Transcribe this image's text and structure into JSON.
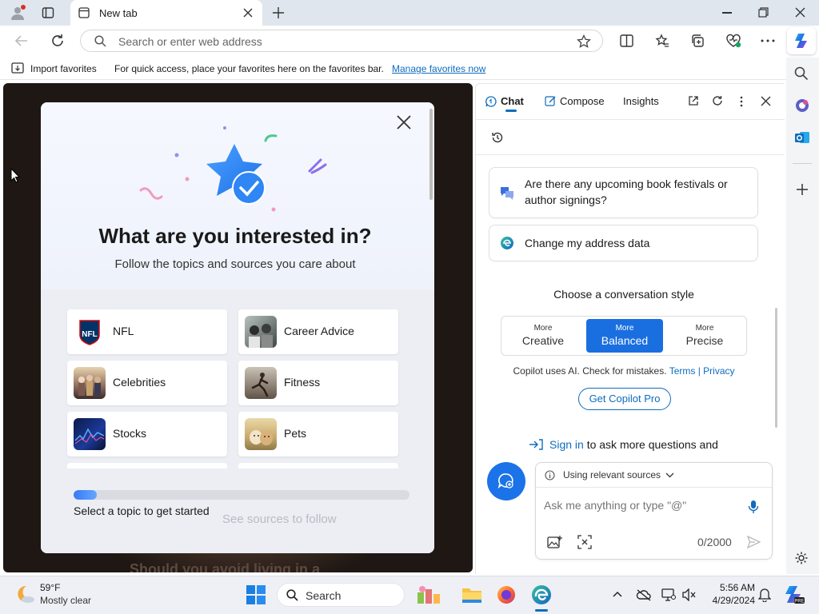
{
  "browser": {
    "tab_title": "New tab",
    "address_placeholder": "Search or enter web address",
    "favorites_bar": {
      "import_label": "Import favorites",
      "hint_text": "For quick access, place your favorites here on the favorites bar.",
      "manage_link": "Manage favorites now"
    }
  },
  "modal": {
    "title": "What are you interested in?",
    "subtitle": "Follow the topics and sources you care about",
    "topics": [
      {
        "label": "NFL",
        "thumb": "nfl-logo"
      },
      {
        "label": "Career Advice",
        "thumb": "career-photo"
      },
      {
        "label": "Celebrities",
        "thumb": "celebrities-photo"
      },
      {
        "label": "Fitness",
        "thumb": "fitness-photo"
      },
      {
        "label": "Stocks",
        "thumb": "stocks-photo"
      },
      {
        "label": "Pets",
        "thumb": "pets-photo"
      }
    ],
    "progress_fraction": 0.07,
    "progress_label": "Select a topic to get started",
    "next_label": "See sources to follow"
  },
  "background_headline": "Should you avoid living in a",
  "copilot": {
    "tabs": {
      "chat": "Chat",
      "compose": "Compose",
      "insights": "Insights"
    },
    "suggestions": [
      {
        "text": "Are there any upcoming book festivals or author signings?"
      },
      {
        "text": "Change my address data"
      }
    ],
    "style_heading": "Choose a conversation style",
    "styles": [
      {
        "small": "More",
        "big": "Creative",
        "selected": false
      },
      {
        "small": "More",
        "big": "Balanced",
        "selected": true
      },
      {
        "small": "More",
        "big": "Precise",
        "selected": false
      }
    ],
    "disclaimer": "Copilot uses AI. Check for mistakes.",
    "terms_link": "Terms",
    "separator": "|",
    "privacy_link": "Privacy",
    "pro_button": "Get Copilot Pro",
    "signin_link": "Sign in",
    "signin_rest": "to ask more questions and",
    "sources_label": "Using relevant sources",
    "input_placeholder": "Ask me anything or type \"@\"",
    "char_count": "0/2000"
  },
  "taskbar": {
    "weather_temp": "59°F",
    "weather_desc": "Mostly clear",
    "search_label": "Search",
    "time": "5:56 AM",
    "date": "4/29/2024"
  },
  "colors": {
    "accent": "#0f6cbd",
    "copilot_blue": "#1a73e8",
    "selected_style": "#1a6fe0"
  }
}
